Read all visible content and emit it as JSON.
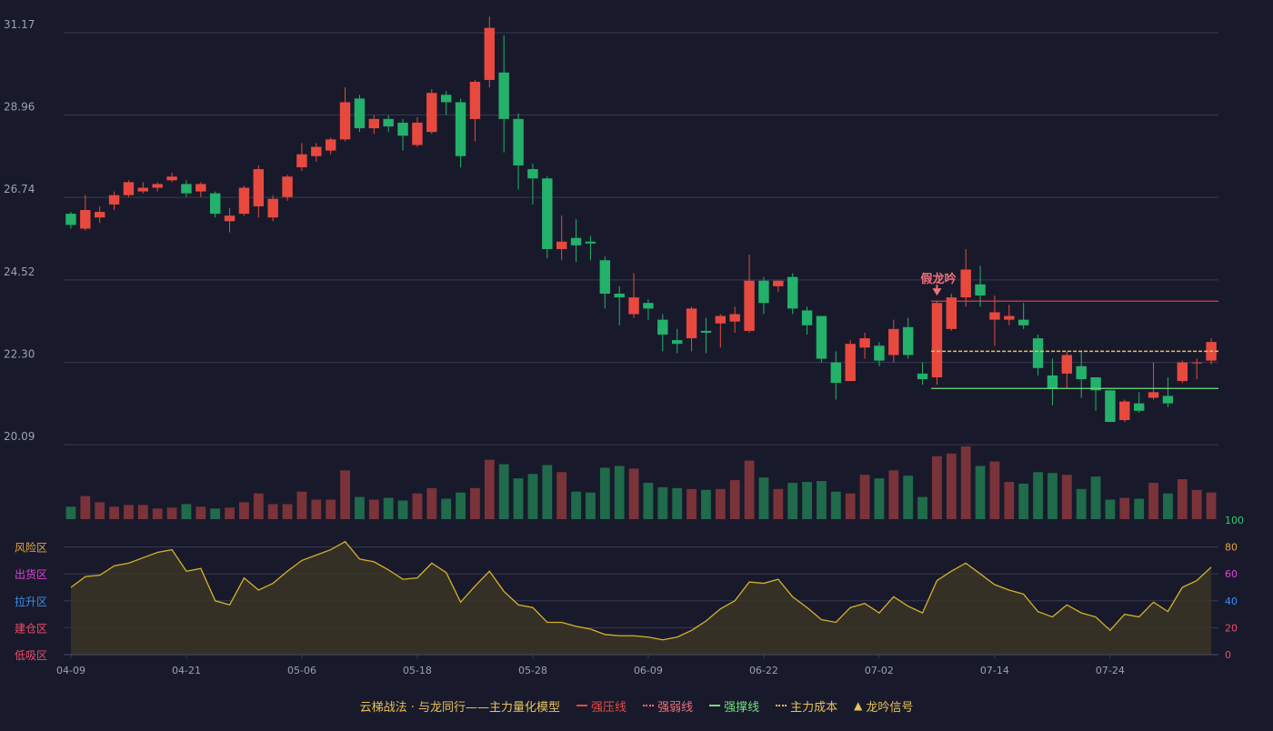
{
  "chart_data": {
    "type": "candlestick",
    "dates": [
      "04-09",
      "04-10",
      "04-11",
      "04-14",
      "04-15",
      "04-16",
      "04-17",
      "04-18",
      "04-21",
      "04-22",
      "04-23",
      "04-24",
      "04-25",
      "04-28",
      "04-29",
      "04-30",
      "05-05",
      "05-06",
      "05-07",
      "05-08",
      "05-09",
      "05-12",
      "05-13",
      "05-14",
      "05-15",
      "05-16",
      "05-19",
      "05-20",
      "05-21",
      "05-22",
      "05-23",
      "05-26",
      "05-27",
      "05-28",
      "05-29",
      "05-30",
      "06-03",
      "06-04",
      "06-05",
      "06-06",
      "06-09",
      "06-10",
      "06-11",
      "06-12",
      "06-13",
      "06-16",
      "06-17",
      "06-18",
      "06-19",
      "06-20",
      "06-23",
      "06-24",
      "06-25",
      "06-26",
      "06-27",
      "06-30",
      "07-01",
      "07-02",
      "07-03",
      "07-04",
      "07-07",
      "07-08",
      "07-09",
      "07-10",
      "07-11",
      "07-14",
      "07-15",
      "07-16",
      "07-17",
      "07-18",
      "07-21",
      "07-22",
      "07-23",
      "07-24",
      "07-25",
      "07-28",
      "07-29",
      "07-30",
      "07-31",
      "08-01"
    ],
    "x_tick_labels": [
      "04-09",
      "04-21",
      "05-06",
      "05-18",
      "05-28",
      "06-09",
      "06-22",
      "07-02",
      "07-14",
      "07-24"
    ],
    "x_tick_indices": [
      0,
      8,
      16,
      24,
      32,
      40,
      48,
      56,
      64,
      72
    ],
    "y_ticks": [
      "20.09",
      "22.30",
      "24.52",
      "26.74",
      "28.96",
      "31.17"
    ],
    "ylim": [
      20.09,
      31.17
    ],
    "candles": [
      [
        26.3,
        26.0,
        26.35,
        25.9
      ],
      [
        25.9,
        26.4,
        26.8,
        25.85
      ],
      [
        26.2,
        26.35,
        26.5,
        26.05
      ],
      [
        26.55,
        26.8,
        26.9,
        26.4
      ],
      [
        26.8,
        27.15,
        27.2,
        26.75
      ],
      [
        26.9,
        27.0,
        27.15,
        26.85
      ],
      [
        27.0,
        27.1,
        27.15,
        26.9
      ],
      [
        27.2,
        27.3,
        27.4,
        27.15
      ],
      [
        27.1,
        26.85,
        27.2,
        26.75
      ],
      [
        26.9,
        27.1,
        27.15,
        26.75
      ],
      [
        26.85,
        26.3,
        26.9,
        26.2
      ],
      [
        26.1,
        26.25,
        26.45,
        25.8
      ],
      [
        26.3,
        27.0,
        27.05,
        26.25
      ],
      [
        26.5,
        27.5,
        27.6,
        26.2
      ],
      [
        26.2,
        26.7,
        26.8,
        26.1
      ],
      [
        26.75,
        27.3,
        27.35,
        26.65
      ],
      [
        27.55,
        27.9,
        28.2,
        27.45
      ],
      [
        27.85,
        28.1,
        28.2,
        27.7
      ],
      [
        28.0,
        28.3,
        28.35,
        27.9
      ],
      [
        28.3,
        29.3,
        29.7,
        28.25
      ],
      [
        29.4,
        28.6,
        29.5,
        28.5
      ],
      [
        28.6,
        28.85,
        28.95,
        28.45
      ],
      [
        28.85,
        28.65,
        28.95,
        28.5
      ],
      [
        28.75,
        28.4,
        28.85,
        28.0
      ],
      [
        28.15,
        28.75,
        28.9,
        28.1
      ],
      [
        28.5,
        29.55,
        29.65,
        28.45
      ],
      [
        29.5,
        29.3,
        29.6,
        28.95
      ],
      [
        29.3,
        27.85,
        29.4,
        27.55
      ],
      [
        28.85,
        29.85,
        29.9,
        28.25
      ],
      [
        29.9,
        31.3,
        31.6,
        29.7
      ],
      [
        30.1,
        28.85,
        31.1,
        27.95
      ],
      [
        28.85,
        27.6,
        29.0,
        26.95
      ],
      [
        27.5,
        27.25,
        27.65,
        26.55
      ],
      [
        27.25,
        25.35,
        27.3,
        25.1
      ],
      [
        25.35,
        25.55,
        26.25,
        25.05
      ],
      [
        25.65,
        25.45,
        26.15,
        25.0
      ],
      [
        25.55,
        25.5,
        25.7,
        25.05
      ],
      [
        25.05,
        24.15,
        25.15,
        23.75
      ],
      [
        24.15,
        24.05,
        24.35,
        23.3
      ],
      [
        23.6,
        24.05,
        24.7,
        23.5
      ],
      [
        23.9,
        23.75,
        24.0,
        23.45
      ],
      [
        23.45,
        23.05,
        23.6,
        22.6
      ],
      [
        22.9,
        22.8,
        23.2,
        22.55
      ],
      [
        22.95,
        23.75,
        23.8,
        22.6
      ],
      [
        23.15,
        23.1,
        23.5,
        22.55
      ],
      [
        23.35,
        23.55,
        23.6,
        22.7
      ],
      [
        23.4,
        23.6,
        23.8,
        23.1
      ],
      [
        23.15,
        24.5,
        25.2,
        23.1
      ],
      [
        24.5,
        23.9,
        24.6,
        23.6
      ],
      [
        24.35,
        24.5,
        24.5,
        24.2
      ],
      [
        24.6,
        23.75,
        24.7,
        23.6
      ],
      [
        23.7,
        23.3,
        23.8,
        23.05
      ],
      [
        23.55,
        22.4,
        23.55,
        22.3
      ],
      [
        22.3,
        21.75,
        22.6,
        21.3
      ],
      [
        21.8,
        22.8,
        22.9,
        21.8
      ],
      [
        22.7,
        22.95,
        23.1,
        22.4
      ],
      [
        22.75,
        22.35,
        22.85,
        22.2
      ],
      [
        22.5,
        23.2,
        23.45,
        22.3
      ],
      [
        23.25,
        22.5,
        23.5,
        22.4
      ],
      [
        22.0,
        21.85,
        22.3,
        21.7
      ],
      [
        21.9,
        23.9,
        23.95,
        21.7
      ],
      [
        23.2,
        24.05,
        24.15,
        23.15
      ],
      [
        24.05,
        24.8,
        25.35,
        23.8
      ],
      [
        24.4,
        24.1,
        24.9,
        23.8
      ],
      [
        23.45,
        23.65,
        24.1,
        22.75
      ],
      [
        23.45,
        23.55,
        23.85,
        23.3
      ],
      [
        23.45,
        23.3,
        23.9,
        23.2
      ],
      [
        22.95,
        22.15,
        23.05,
        21.95
      ],
      [
        21.95,
        21.6,
        22.4,
        21.15
      ],
      [
        22.0,
        22.5,
        22.6,
        21.6
      ],
      [
        22.2,
        21.85,
        22.6,
        21.35
      ],
      [
        21.9,
        21.55,
        21.9,
        21.0
      ],
      [
        21.55,
        20.7,
        21.55,
        20.7
      ],
      [
        20.75,
        21.25,
        21.3,
        20.7
      ],
      [
        21.2,
        21.0,
        21.5,
        20.95
      ],
      [
        21.35,
        21.5,
        22.3,
        21.3
      ],
      [
        21.4,
        21.2,
        21.9,
        21.1
      ],
      [
        21.8,
        22.3,
        22.35,
        21.75
      ],
      [
        22.3,
        22.3,
        22.4,
        21.85
      ],
      [
        22.35,
        22.85,
        22.95,
        22.25
      ]
    ],
    "volume": [
      14,
      26,
      19,
      14,
      16,
      16,
      12,
      13,
      17,
      14,
      12,
      13,
      19,
      29,
      17,
      17,
      31,
      22,
      22,
      55,
      25,
      22,
      24,
      21,
      29,
      35,
      23,
      30,
      35,
      67,
      62,
      46,
      51,
      61,
      53,
      31,
      30,
      58,
      60,
      57,
      41,
      36,
      35,
      34,
      33,
      34,
      44,
      66,
      47,
      34,
      41,
      42,
      43,
      31,
      29,
      50,
      46,
      55,
      49,
      25,
      71,
      74,
      82,
      60,
      65,
      42,
      40,
      53,
      52,
      50,
      34,
      48,
      22,
      24,
      23,
      41,
      29,
      45,
      33,
      30
    ],
    "oscillator": [
      50,
      58,
      59,
      66,
      68,
      72,
      76,
      78,
      62,
      64,
      40,
      37,
      57,
      48,
      53,
      62,
      70,
      74,
      78,
      84,
      71,
      69,
      63,
      56,
      57,
      68,
      61,
      39,
      51,
      62,
      47,
      37,
      35,
      24,
      24,
      21,
      19,
      15,
      14,
      14,
      13,
      11,
      13,
      18,
      25,
      34,
      40,
      54,
      53,
      56,
      43,
      35,
      26,
      24,
      35,
      38,
      31,
      43,
      36,
      31,
      55,
      62,
      68,
      60,
      52,
      48,
      45,
      32,
      28,
      37,
      31,
      28,
      18,
      30,
      28,
      39,
      32,
      50,
      55,
      65
    ],
    "oscillator_ticks_right": [
      "100",
      "80",
      "60",
      "40",
      "20",
      "0"
    ],
    "oscillator_zones": [
      "风险区",
      "出货区",
      "拉升区",
      "建仓区",
      "低吸区"
    ],
    "signal_label": "假龙吟",
    "signal_index": 60,
    "level_lines": {
      "resistance": 23.95,
      "cost": 22.6,
      "support": 21.6,
      "start_index": 60
    },
    "colors": {
      "up": "#e8493f",
      "down": "#23b16b",
      "volume_up": "#7a3339",
      "volume_down": "#1f6b4b",
      "grid": "#373a52",
      "axis_text": "#9aa0b8",
      "oscillator_line": "#d6b12a",
      "zone_risk": "#e8a23a",
      "zone_distribute": "#e040d8",
      "zone_lift": "#3d8df0",
      "zone_build": "#f04a6a",
      "zone_low": "#f04a6a",
      "tick_100": "#2ecc71",
      "tick_80": "#e8a23a",
      "tick_60": "#e040d8",
      "tick_40": "#3d8df0",
      "tick_20": "#f04a6a",
      "tick_0": "#f04a6a"
    }
  },
  "legend": {
    "title": "云梯战法 · 与龙同行——主力量化模型",
    "items": [
      {
        "label": "强压线",
        "color": "#e8493f",
        "style": "solid"
      },
      {
        "label": "强弱线",
        "color": "#f2707a",
        "style": "dotted"
      },
      {
        "label": "强撑线",
        "color": "#6ee07a",
        "style": "solid"
      },
      {
        "label": "主力成本",
        "color": "#e8c15a",
        "style": "dotted"
      },
      {
        "label": "龙吟信号",
        "color": "#e8c15a",
        "style": "triangle"
      }
    ]
  }
}
